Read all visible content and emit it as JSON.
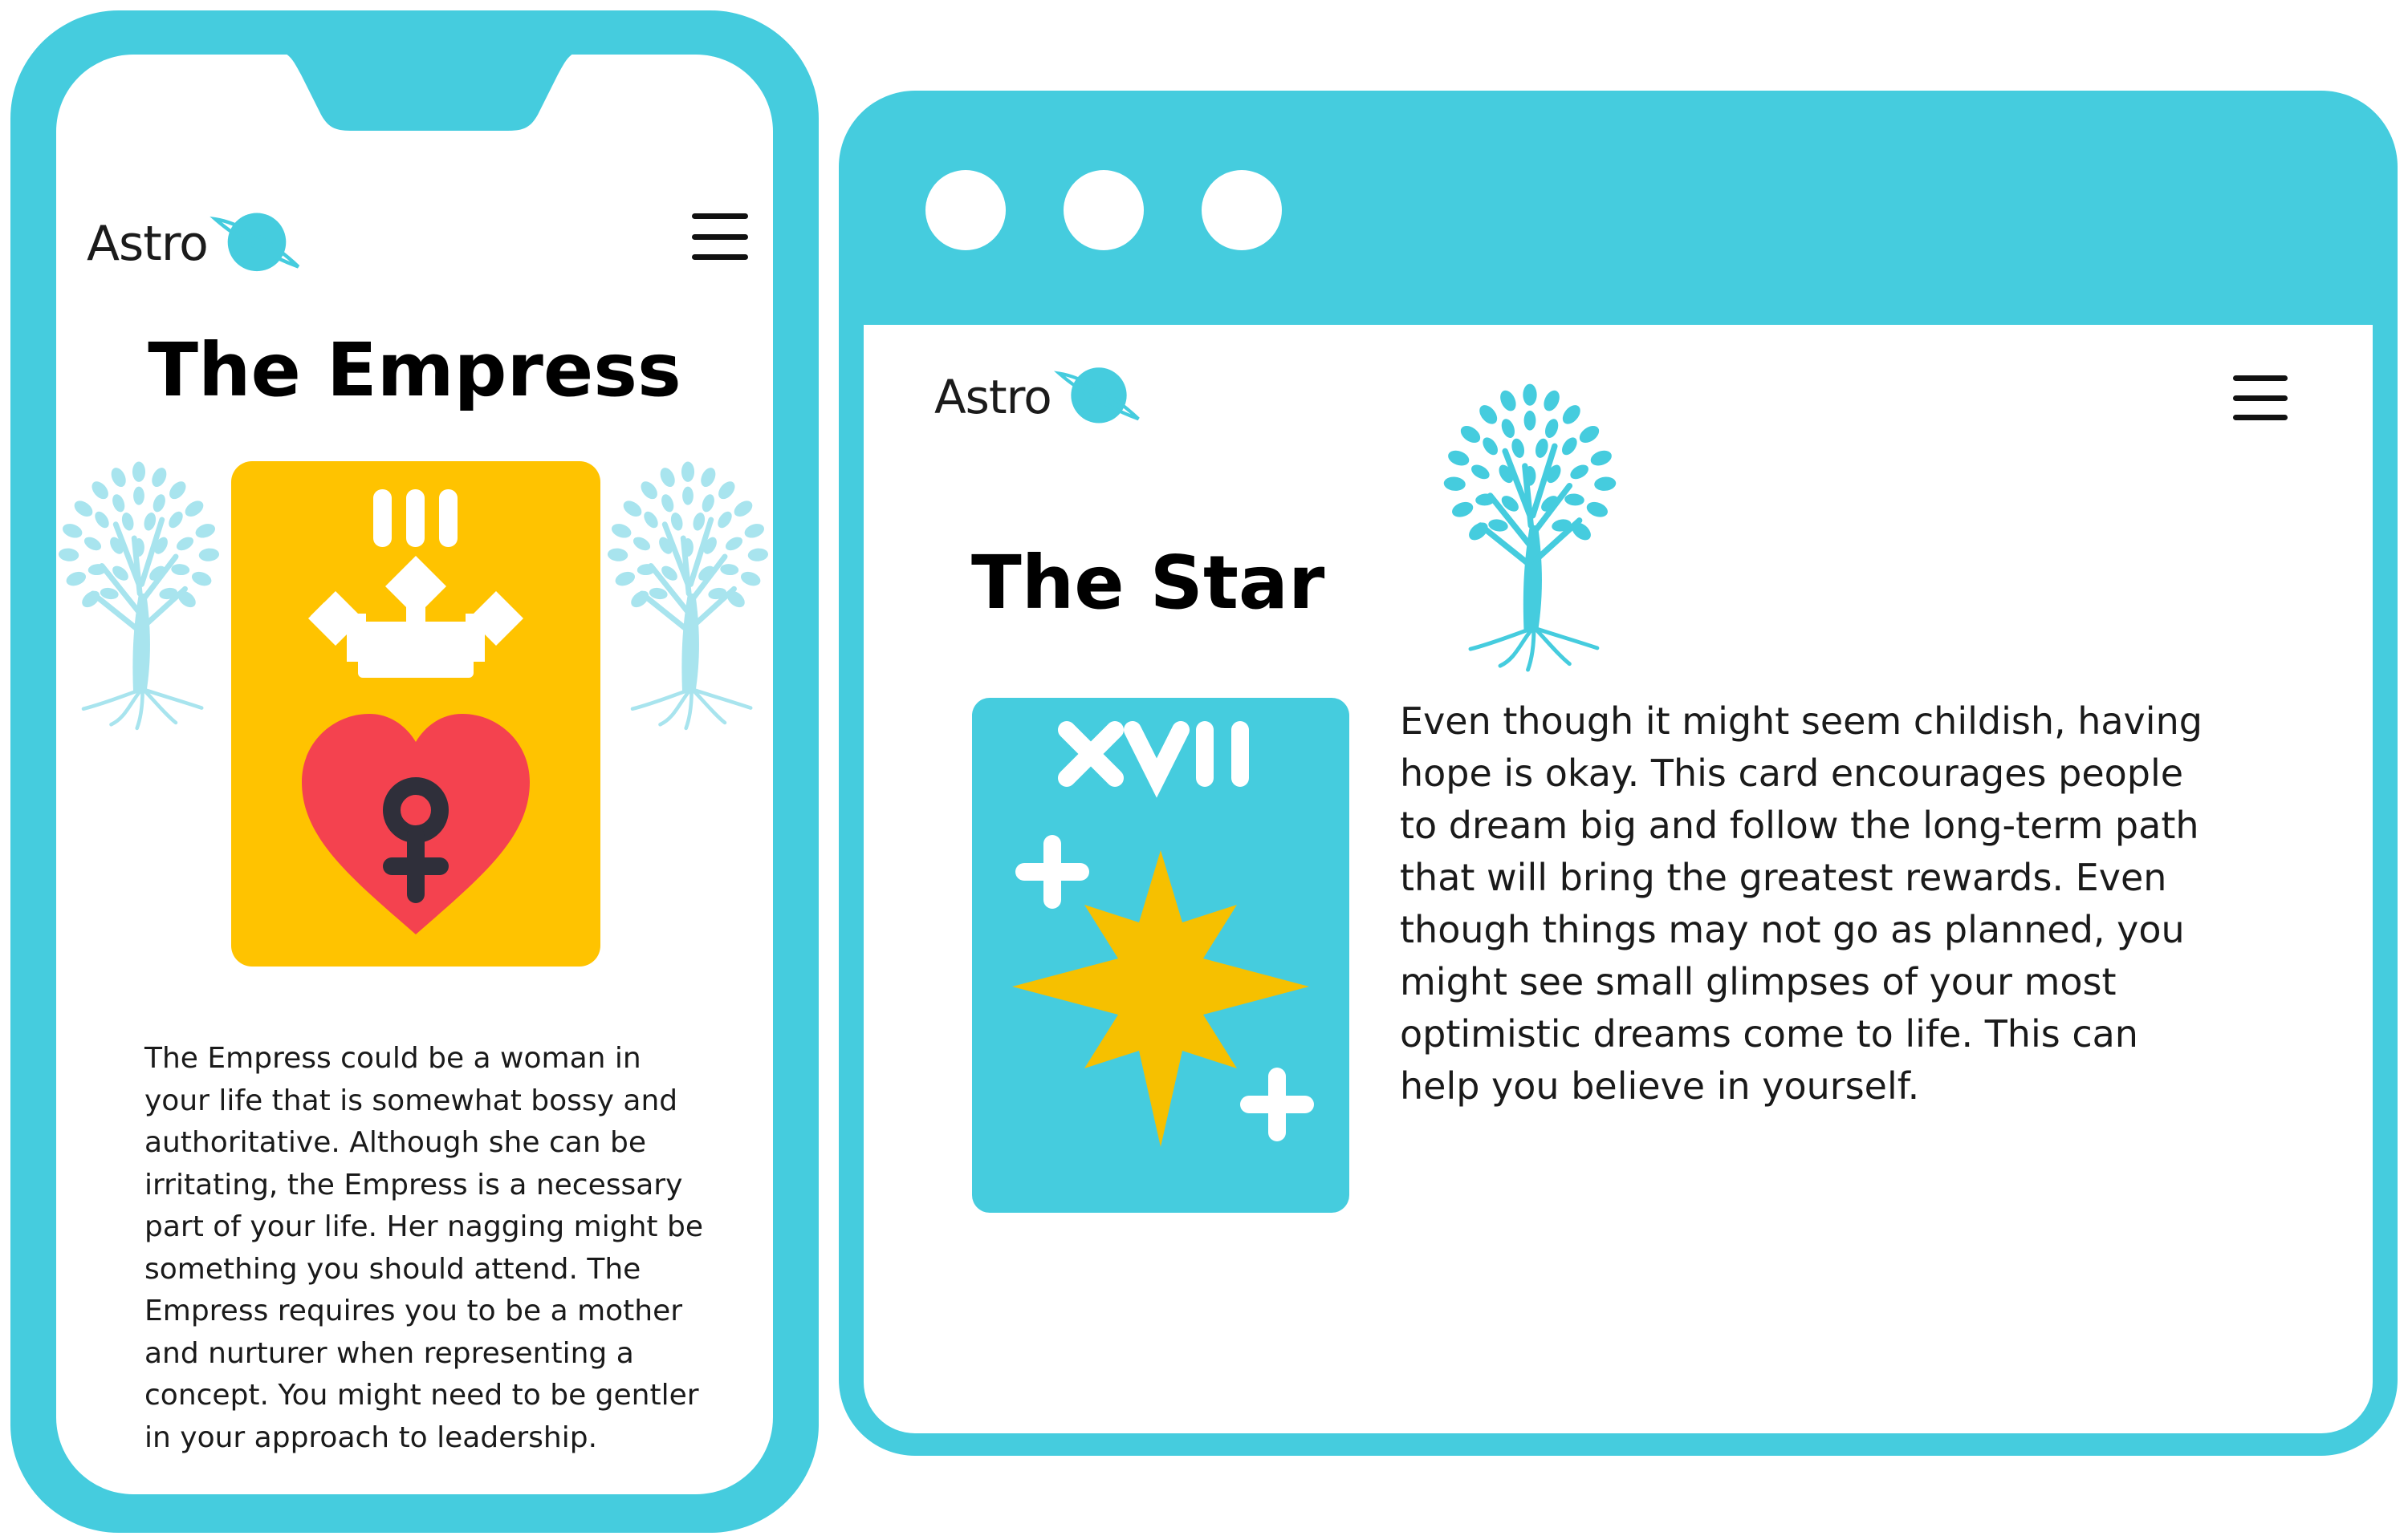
{
  "colors": {
    "accent": "#45CCDE",
    "empress_card": "#FFC300",
    "heart": "#F4424F",
    "star": "#F6C000",
    "text": "#1a1a1a"
  },
  "phone": {
    "brand": "Astro",
    "menu_icon": "hamburger-menu-icon",
    "title": "The Empress",
    "card": {
      "numeral": "III",
      "symbols": [
        "crown-icon",
        "heart-icon",
        "venus-icon"
      ]
    },
    "description": "The Empress could be a woman in your life that is somewhat bossy and authoritative. Although she can be irritating, the Empress is a necessary part of your life. Her nagging might be something you should attend. The Empress requires you to be a mother and nurturer when representing a concept. You might need to be gentler in your approach to leadership."
  },
  "browser": {
    "window_controls": [
      "window-dot",
      "window-dot",
      "window-dot"
    ],
    "brand": "Astro",
    "menu_icon": "hamburger-menu-icon",
    "title": "The Star",
    "card": {
      "numeral": "XVII",
      "symbols": [
        "star-icon",
        "sparkle-icon",
        "sparkle-icon"
      ]
    },
    "description": "Even though it might seem childish, having hope is okay. This card encourages people to dream big and follow the long-term path that will bring the greatest rewards. Even though things may not go as planned, you might see small glimpses of your most optimistic dreams come to life. This can help you believe in yourself."
  }
}
